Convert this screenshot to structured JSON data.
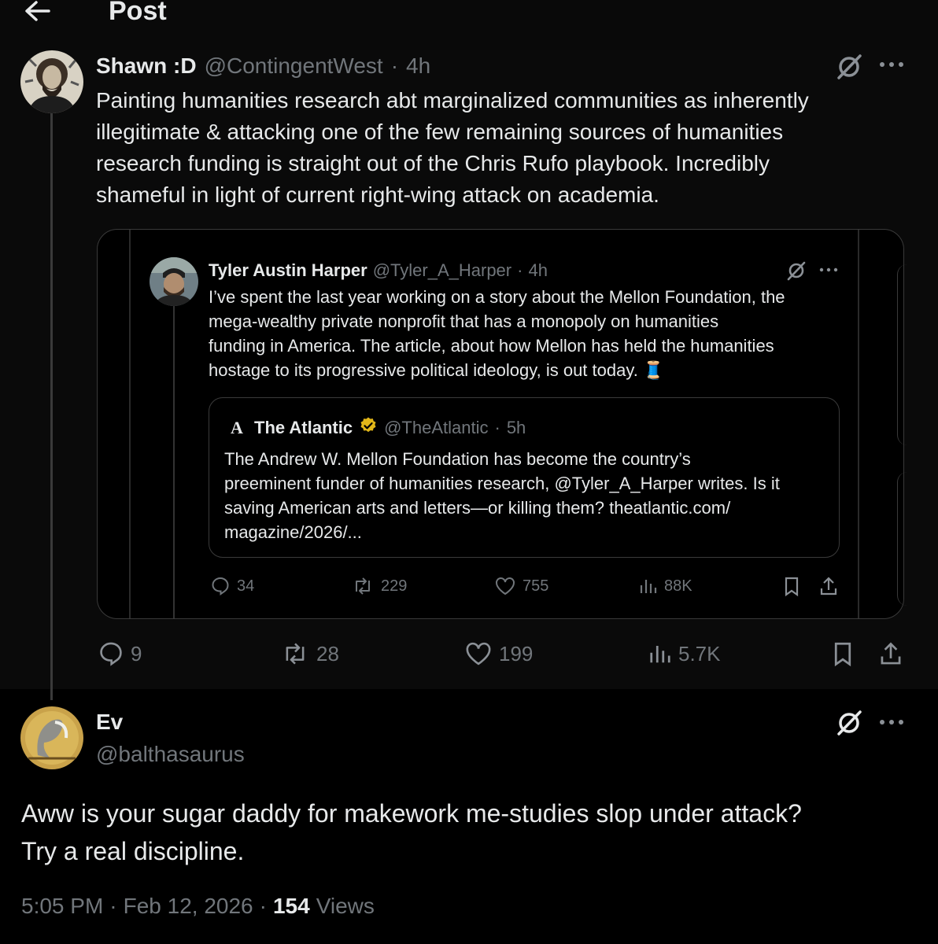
{
  "header": {
    "title": "Post"
  },
  "parent": {
    "display_name": "Shawn :D",
    "handle": "@ContingentWest",
    "time": "4h",
    "text_lines": [
      "Painting humanities research abt marginalized communities as inherently",
      "illegitimate & attacking one of the few remaining sources of humanities",
      "research funding is straight out of the Chris Rufo playbook. Incredibly",
      "shameful in light of current right-wing attack on academia."
    ],
    "stats": {
      "replies": "9",
      "reposts": "28",
      "likes": "199",
      "views": "5.7K"
    }
  },
  "quoted": {
    "display_name": "Tyler Austin Harper",
    "handle": "@Tyler_A_Harper",
    "time": "4h",
    "text_lines": [
      "I’ve spent the last year working on a story about the Mellon Foundation, the",
      "mega-wealthy private nonprofit that has a monopoly on humanities",
      "funding in America. The article, about how Mellon has held the humanities",
      "hostage to its progressive political ideology, is out today. 🧵"
    ],
    "stats": {
      "replies": "34",
      "reposts": "229",
      "likes": "755",
      "views": "88K"
    }
  },
  "nested": {
    "logo": "A",
    "display_name": "The Atlantic",
    "handle": "@TheAtlantic",
    "time": "5h",
    "text_lines": [
      "The Andrew W. Mellon Foundation has become the country’s",
      "preeminent funder of humanities research, @Tyler_A_Harper writes. Is it",
      "saving American arts and letters—or killing them? theatlantic.com/",
      "magazine/2026/..."
    ]
  },
  "reply": {
    "display_name": "Ev",
    "handle": "@balthasaurus",
    "text_lines": [
      "Aww is your sugar daddy for makework me-studies slop under attack?",
      "Try a real discipline."
    ],
    "time": "5:05 PM",
    "date": "Feb 12, 2026",
    "views_count": "154",
    "views_label": "Views"
  },
  "separator": "·",
  "colors": {
    "background": "#000000",
    "text": "#e7e9ea",
    "muted": "#71767b",
    "verified": "#e2b719",
    "border": "#3a3a3a"
  }
}
